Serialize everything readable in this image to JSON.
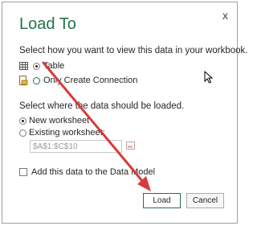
{
  "dialog": {
    "title": "Load To",
    "close_symbol": "x",
    "view_prompt": "Select how you want to view this data in your workbook.",
    "view_options": [
      {
        "label": "Table",
        "selected": true,
        "icon": "table-icon"
      },
      {
        "label": "Only Create Connection",
        "selected": false,
        "icon": "connection-icon"
      }
    ],
    "location_prompt": "Select where the data should be loaded.",
    "location_options": [
      {
        "label": "New worksheet",
        "selected": true
      },
      {
        "label": "Existing worksheet:",
        "selected": false
      }
    ],
    "range_value": "$A$1:$C$10",
    "data_model_label": "Add this data to the Data Model",
    "data_model_checked": false,
    "load_label": "Load",
    "cancel_label": "Cancel"
  },
  "colors": {
    "title": "#217346",
    "annotation_arrow": "#d83b3b"
  }
}
